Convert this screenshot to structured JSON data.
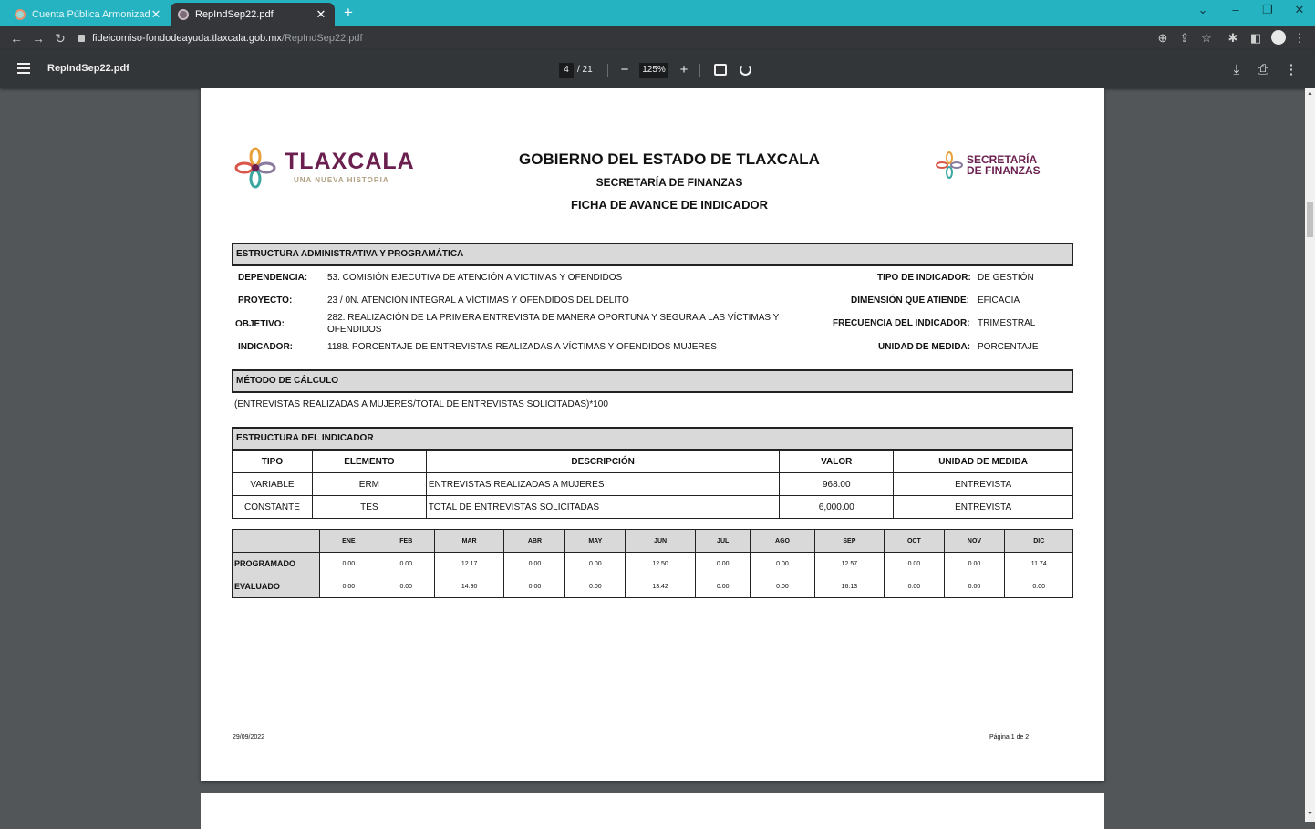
{
  "browser": {
    "tabs": [
      {
        "title": "Cuenta Pública Armonizada julio",
        "active": false
      },
      {
        "title": "RepIndSep22.pdf",
        "active": true
      }
    ],
    "url_host": "fideicomiso-fondodeayuda.tlaxcala.gob.mx",
    "url_path": "/RepIndSep22.pdf",
    "accent_color": "#26b3c1"
  },
  "pdf_toolbar": {
    "title": "RepIndSep22.pdf",
    "current_page": "4",
    "total_pages": "/ 21",
    "zoom": "125%"
  },
  "document": {
    "brand": "TLAXCALA",
    "tagline": "UNA NUEVA HISTORIA",
    "secretaria_line1": "SECRETARÍA",
    "secretaria_line2": "DE FINANZAS",
    "heading": "GOBIERNO DEL ESTADO DE TLAXCALA",
    "subheading": "SECRETARÍA DE FINANZAS",
    "form_title": "FICHA DE AVANCE DE INDICADOR",
    "sections": {
      "admin": "ESTRUCTURA ADMINISTRATIVA Y PROGRAMÁTICA",
      "metodo": "MÉTODO DE CÁLCULO",
      "estructura": "ESTRUCTURA DEL INDICADOR"
    },
    "fields": {
      "dependencia_label": "DEPENDENCIA:",
      "dependencia": "53. COMISIÓN EJECUTIVA DE ATENCIÓN A VICTIMAS Y OFENDIDOS",
      "proyecto_label": "PROYECTO:",
      "proyecto": "23 / 0N. ATENCIÓN INTEGRAL A VÍCTIMAS Y OFENDIDOS DEL DELITO",
      "objetivo_label": "OBJETIVO:",
      "objetivo_l1": "282. REALIZACIÓN DE LA PRIMERA ENTREVISTA DE MANERA OPORTUNA Y SEGURA A LAS VÍCTIMAS Y",
      "objetivo_l2": "OFENDIDOS",
      "indicador_label": "INDICADOR:",
      "indicador": "1188. PORCENTAJE DE ENTREVISTAS REALIZADAS A VÍCTIMAS Y OFENDIDOS MUJERES",
      "tipo_label": "TIPO DE INDICADOR:",
      "tipo": "DE GESTIÓN",
      "dimension_label": "DIMENSIÓN QUE ATIENDE:",
      "dimension": "EFICACIA",
      "frecuencia_label": "FRECUENCIA DEL INDICADOR:",
      "frecuencia": "TRIMESTRAL",
      "unidad_label": "UNIDAD DE MEDIDA:",
      "unidad": "PORCENTAJE"
    },
    "metodo": "(ENTREVISTAS REALIZADAS A MUJERES/TOTAL DE ENTREVISTAS SOLICITADAS)*100",
    "indicator_table": {
      "headers": [
        "TIPO",
        "ELEMENTO",
        "DESCRIPCIÓN",
        "VALOR",
        "UNIDAD DE MEDIDA"
      ],
      "rows": [
        [
          "VARIABLE",
          "ERM",
          "ENTREVISTAS REALIZADAS A MUJERES",
          "968.00",
          "ENTREVISTA"
        ],
        [
          "CONSTANTE",
          "TES",
          "TOTAL DE ENTREVISTAS SOLICITADAS",
          "6,000.00",
          "ENTREVISTA"
        ]
      ]
    },
    "monthly_table": {
      "months": [
        "ENE",
        "FEB",
        "MAR",
        "ABR",
        "MAY",
        "JUN",
        "JUL",
        "AGO",
        "SEP",
        "OCT",
        "NOV",
        "DIC"
      ],
      "rows": [
        {
          "label": "PROGRAMADO",
          "values": [
            "0.00",
            "0.00",
            "12.17",
            "0.00",
            "0.00",
            "12.50",
            "0.00",
            "0.00",
            "12.57",
            "0.00",
            "0.00",
            "11.74"
          ]
        },
        {
          "label": "EVALUADO",
          "values": [
            "0.00",
            "0.00",
            "14.90",
            "0.00",
            "0.00",
            "13.42",
            "0.00",
            "0.00",
            "16.13",
            "0.00",
            "0.00",
            "0.00"
          ]
        }
      ]
    },
    "footer_date": "29/09/2022",
    "footer_page": "Página 1 de 2"
  }
}
